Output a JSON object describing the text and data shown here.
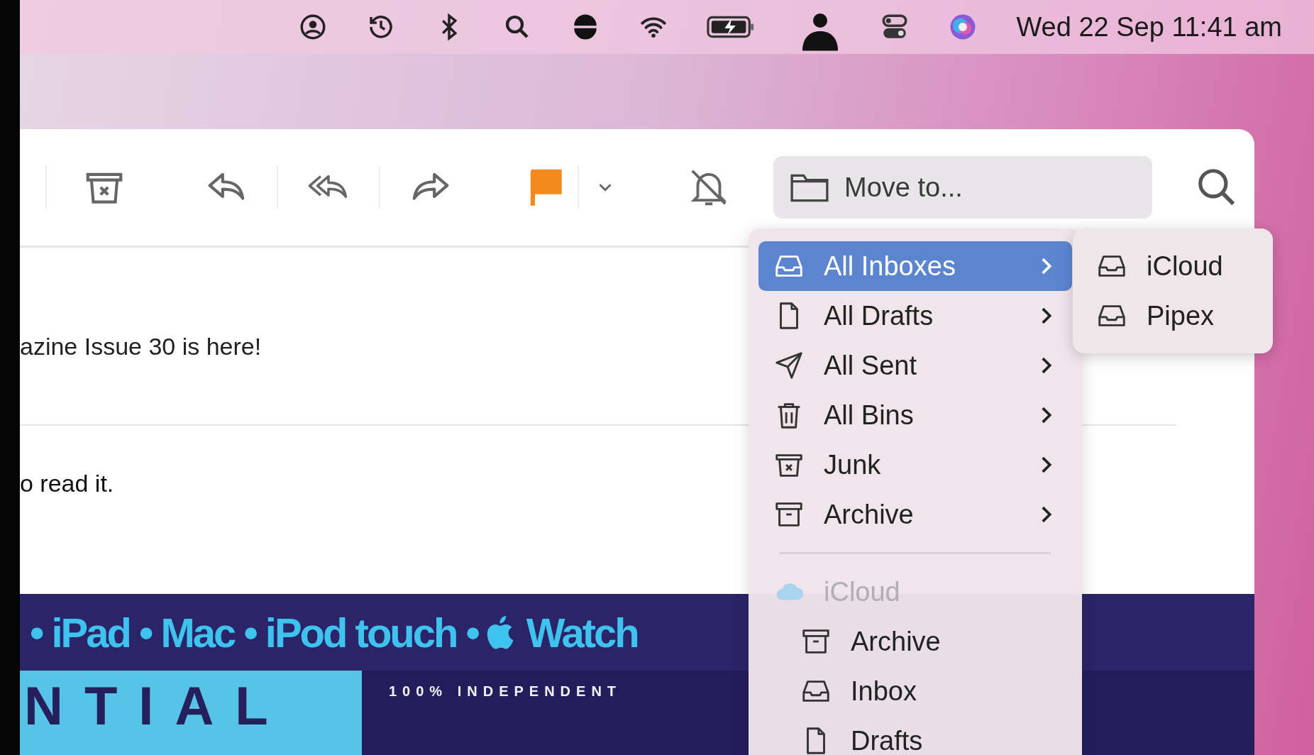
{
  "menu_bar": {
    "clock": "Wed 22 Sep  11:41 am"
  },
  "toolbar": {
    "flagged": true,
    "move_to": {
      "label": "Move to..."
    }
  },
  "message": {
    "subject": "azine Issue 30 is here!",
    "body": "o read it.",
    "banner": {
      "devices": "• iPad • Mac • iPod touch •",
      "watch": "Watch",
      "title": "NTIAL",
      "tagline": "100% INDEPENDENT"
    }
  },
  "move_menu": {
    "items": [
      {
        "label": "All Inboxes",
        "kind": "inbox",
        "selected": true,
        "submenu": true
      },
      {
        "label": "All Drafts",
        "kind": "doc",
        "selected": false,
        "submenu": true
      },
      {
        "label": "All Sent",
        "kind": "send",
        "selected": false,
        "submenu": true
      },
      {
        "label": "All Bins",
        "kind": "trash",
        "selected": false,
        "submenu": true
      },
      {
        "label": "Junk",
        "kind": "junk",
        "selected": false,
        "submenu": true
      },
      {
        "label": "Archive",
        "kind": "archive",
        "selected": false,
        "submenu": true
      }
    ],
    "accounts": [
      {
        "label": "iCloud",
        "kind": "cloud",
        "disabled": true,
        "children": [
          {
            "label": "Archive",
            "kind": "archive",
            "selected": false
          },
          {
            "label": "Inbox",
            "kind": "inbox",
            "selected": false
          },
          {
            "label": "Drafts",
            "kind": "doc",
            "selected": false
          }
        ]
      }
    ]
  },
  "submenu": {
    "items": [
      {
        "label": "iCloud",
        "kind": "inbox",
        "selected": false
      },
      {
        "label": "Pipex",
        "kind": "inbox",
        "selected": false
      }
    ]
  }
}
